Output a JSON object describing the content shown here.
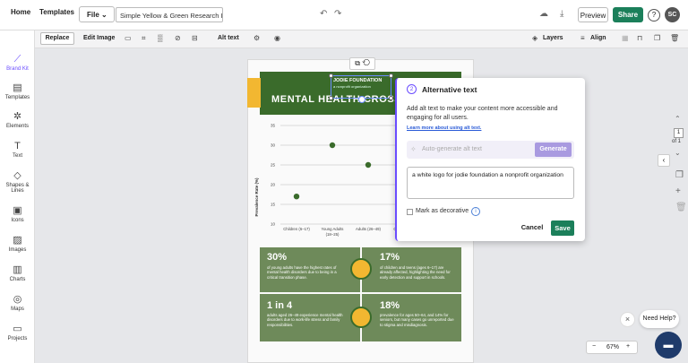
{
  "topbar": {
    "home": "Home",
    "templates": "Templates",
    "file": "File",
    "doc_name": "Simple Yellow & Green Research I...",
    "preview": "Preview",
    "share": "Share",
    "help": "?",
    "avatar": "SC"
  },
  "toolbar": {
    "replace": "Replace",
    "edit_image": "Edit Image",
    "alt_text": "Alt text",
    "layers": "Layers",
    "align": "Align"
  },
  "sidebar": {
    "items": [
      {
        "label": "Brand Kit",
        "icon": "magic-wand-icon",
        "glyph": "⟋"
      },
      {
        "label": "Templates",
        "icon": "templates-icon",
        "glyph": "▤"
      },
      {
        "label": "Elements",
        "icon": "elements-icon",
        "glyph": "✲"
      },
      {
        "label": "Text",
        "icon": "text-icon",
        "glyph": "T"
      },
      {
        "label": "Shapes & Lines",
        "icon": "shapes-icon",
        "glyph": "◇"
      },
      {
        "label": "Icons",
        "icon": "icons-icon",
        "glyph": "▣"
      },
      {
        "label": "Images",
        "icon": "image-icon",
        "glyph": "▨"
      },
      {
        "label": "Charts",
        "icon": "chart-icon",
        "glyph": "▥"
      },
      {
        "label": "Maps",
        "icon": "globe-icon",
        "glyph": "◎"
      },
      {
        "label": "Projects",
        "icon": "folder-icon",
        "glyph": "▭"
      }
    ]
  },
  "canvas": {
    "logo_name": "JODIE FOUNDATION",
    "logo_sub": "a nonprofit organization",
    "title": "MENTAL HEALTH CROSS",
    "chart": {
      "ylabel": "Prevalence Rate (%)",
      "yticks": [
        "35",
        "30",
        "25",
        "20",
        "15",
        "10"
      ],
      "xticks": [
        "Children (6–17)",
        "Young Adults",
        "Adults (26–49)",
        "O"
      ],
      "xticks2": [
        "",
        "(18–25)",
        "",
        ""
      ]
    },
    "stats": [
      {
        "big": "30%",
        "small": "of young adults have the highest rates of mental health disorders due to being in a critical transition phase."
      },
      {
        "big": "17%",
        "small": "of children and teens (ages 6–17) are already affected, highlighting the need for early detection and support in schools."
      },
      {
        "big": "1 in 4",
        "small": "adults aged 26–49 experience mental health disorders due to work-life stress and family responsibilities."
      },
      {
        "big": "18%",
        "small": "prevalence for ages 50–64, and 14% for seniors, but many cases go unreported due to stigma and misdiagnosis."
      }
    ]
  },
  "panel": {
    "step": "2",
    "title": "Alternative text",
    "desc": "Add alt text to make your content more accessible and engaging for all users.",
    "link": "Learn more about using alt text.",
    "autogen_placeholder": "Auto-generate alt text",
    "generate": "Generate",
    "alt_value": "a white logo for jodie foundation a nonprofit organization",
    "decorative": "Mark as decorative",
    "cancel": "Cancel",
    "save": "Save"
  },
  "rail": {
    "page": "1",
    "of": "of 1"
  },
  "zoom": {
    "minus": "−",
    "value": "67%",
    "plus": "+"
  },
  "help": {
    "close": "×",
    "need_help": "Need Help?"
  },
  "colors": {
    "brand_green": "#1b7f5a",
    "infographic_green": "#3a6b2b",
    "accent_yellow": "#f2b731",
    "panel_accent": "#6a4cff"
  },
  "chart_data": {
    "type": "scatter",
    "series": [
      {
        "x": [
          "Children (6–17)",
          "Young Adults (18–25)",
          "Adults (26–49)"
        ],
        "values": [
          17,
          30,
          25
        ]
      }
    ],
    "ylabel": "Prevalence Rate (%)",
    "ylim": [
      10,
      35
    ]
  }
}
